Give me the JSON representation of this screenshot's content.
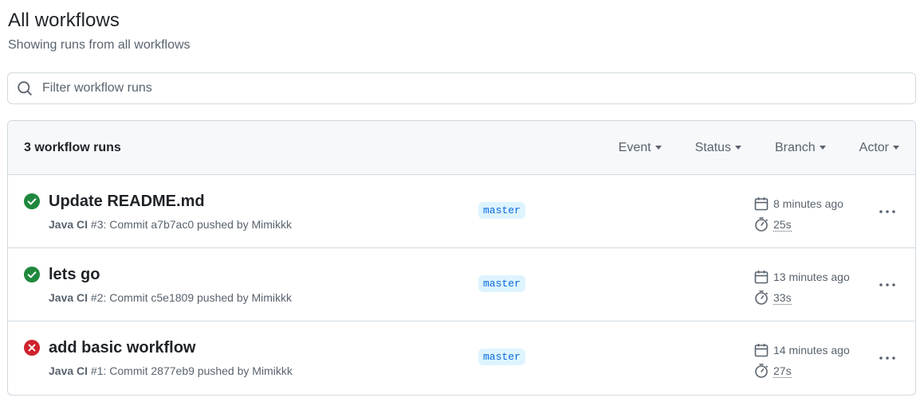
{
  "header": {
    "title": "All workflows",
    "subtitle": "Showing runs from all workflows"
  },
  "search": {
    "placeholder": "Filter workflow runs",
    "value": ""
  },
  "runs_header": {
    "count_label": "3 workflow runs",
    "filters": [
      "Event",
      "Status",
      "Branch",
      "Actor"
    ]
  },
  "runs": [
    {
      "status": "success",
      "title": "Update README.md",
      "workflow": "Java CI",
      "meta": " #3: Commit a7b7ac0 pushed by Mimikkk",
      "branch": "master",
      "time_ago": "8 minutes ago",
      "duration": "25s"
    },
    {
      "status": "success",
      "title": "lets go",
      "workflow": "Java CI",
      "meta": " #2: Commit c5e1809 pushed by Mimikkk",
      "branch": "master",
      "time_ago": "13 minutes ago",
      "duration": "33s"
    },
    {
      "status": "failure",
      "title": "add basic workflow",
      "workflow": "Java CI",
      "meta": " #1: Commit 2877eb9 pushed by Mimikkk",
      "branch": "master",
      "time_ago": "14 minutes ago",
      "duration": "27s"
    }
  ],
  "colors": {
    "success": "#1f883d",
    "failure": "#cf222e",
    "branch_bg": "#ddf4ff",
    "branch_fg": "#0969da",
    "muted": "#59636e"
  },
  "icons": {
    "search": "search-icon",
    "success": "check-circle-fill-icon",
    "failure": "x-circle-fill-icon",
    "calendar": "calendar-icon",
    "stopwatch": "stopwatch-icon",
    "kebab": "kebab-horizontal-icon",
    "caret": "triangle-down-icon"
  }
}
